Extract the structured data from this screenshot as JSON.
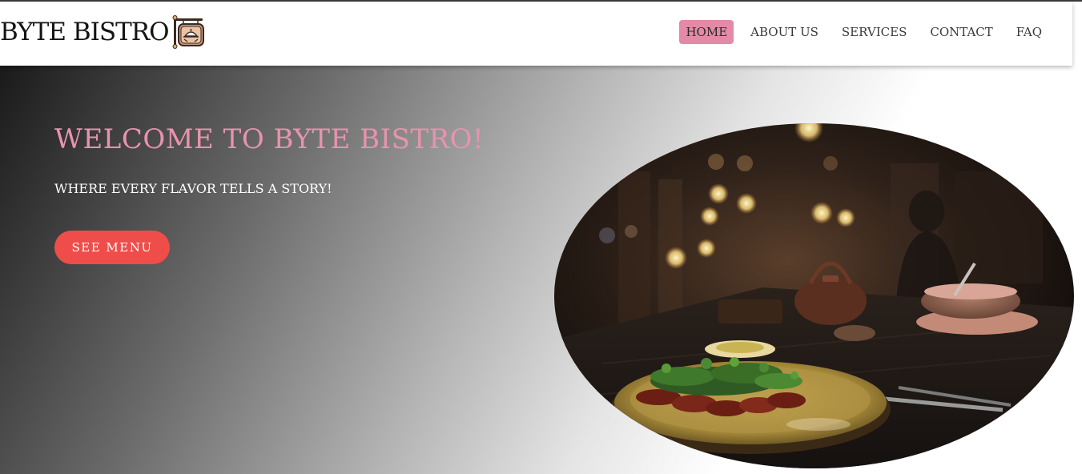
{
  "brand": {
    "name": "BYTE BISTRO"
  },
  "nav": {
    "items": [
      {
        "label": "HOME",
        "active": true
      },
      {
        "label": "ABOUT US",
        "active": false
      },
      {
        "label": "SERVICES",
        "active": false
      },
      {
        "label": "CONTACT",
        "active": false
      },
      {
        "label": "FAQ",
        "active": false
      }
    ]
  },
  "hero": {
    "title": "WELCOME TO BYTE BISTRO!",
    "subtitle": "WHERE EVERY FLAVOR TELLS A STORY!",
    "cta_label": "SEE MENU"
  },
  "colors": {
    "accent_pink": "#e893ad",
    "nav_active_bg": "#e38aa6",
    "cta_red": "#ee4d4a",
    "brand_text": "#141414"
  },
  "icons": {
    "logo": "restaurant-sign-icon"
  }
}
